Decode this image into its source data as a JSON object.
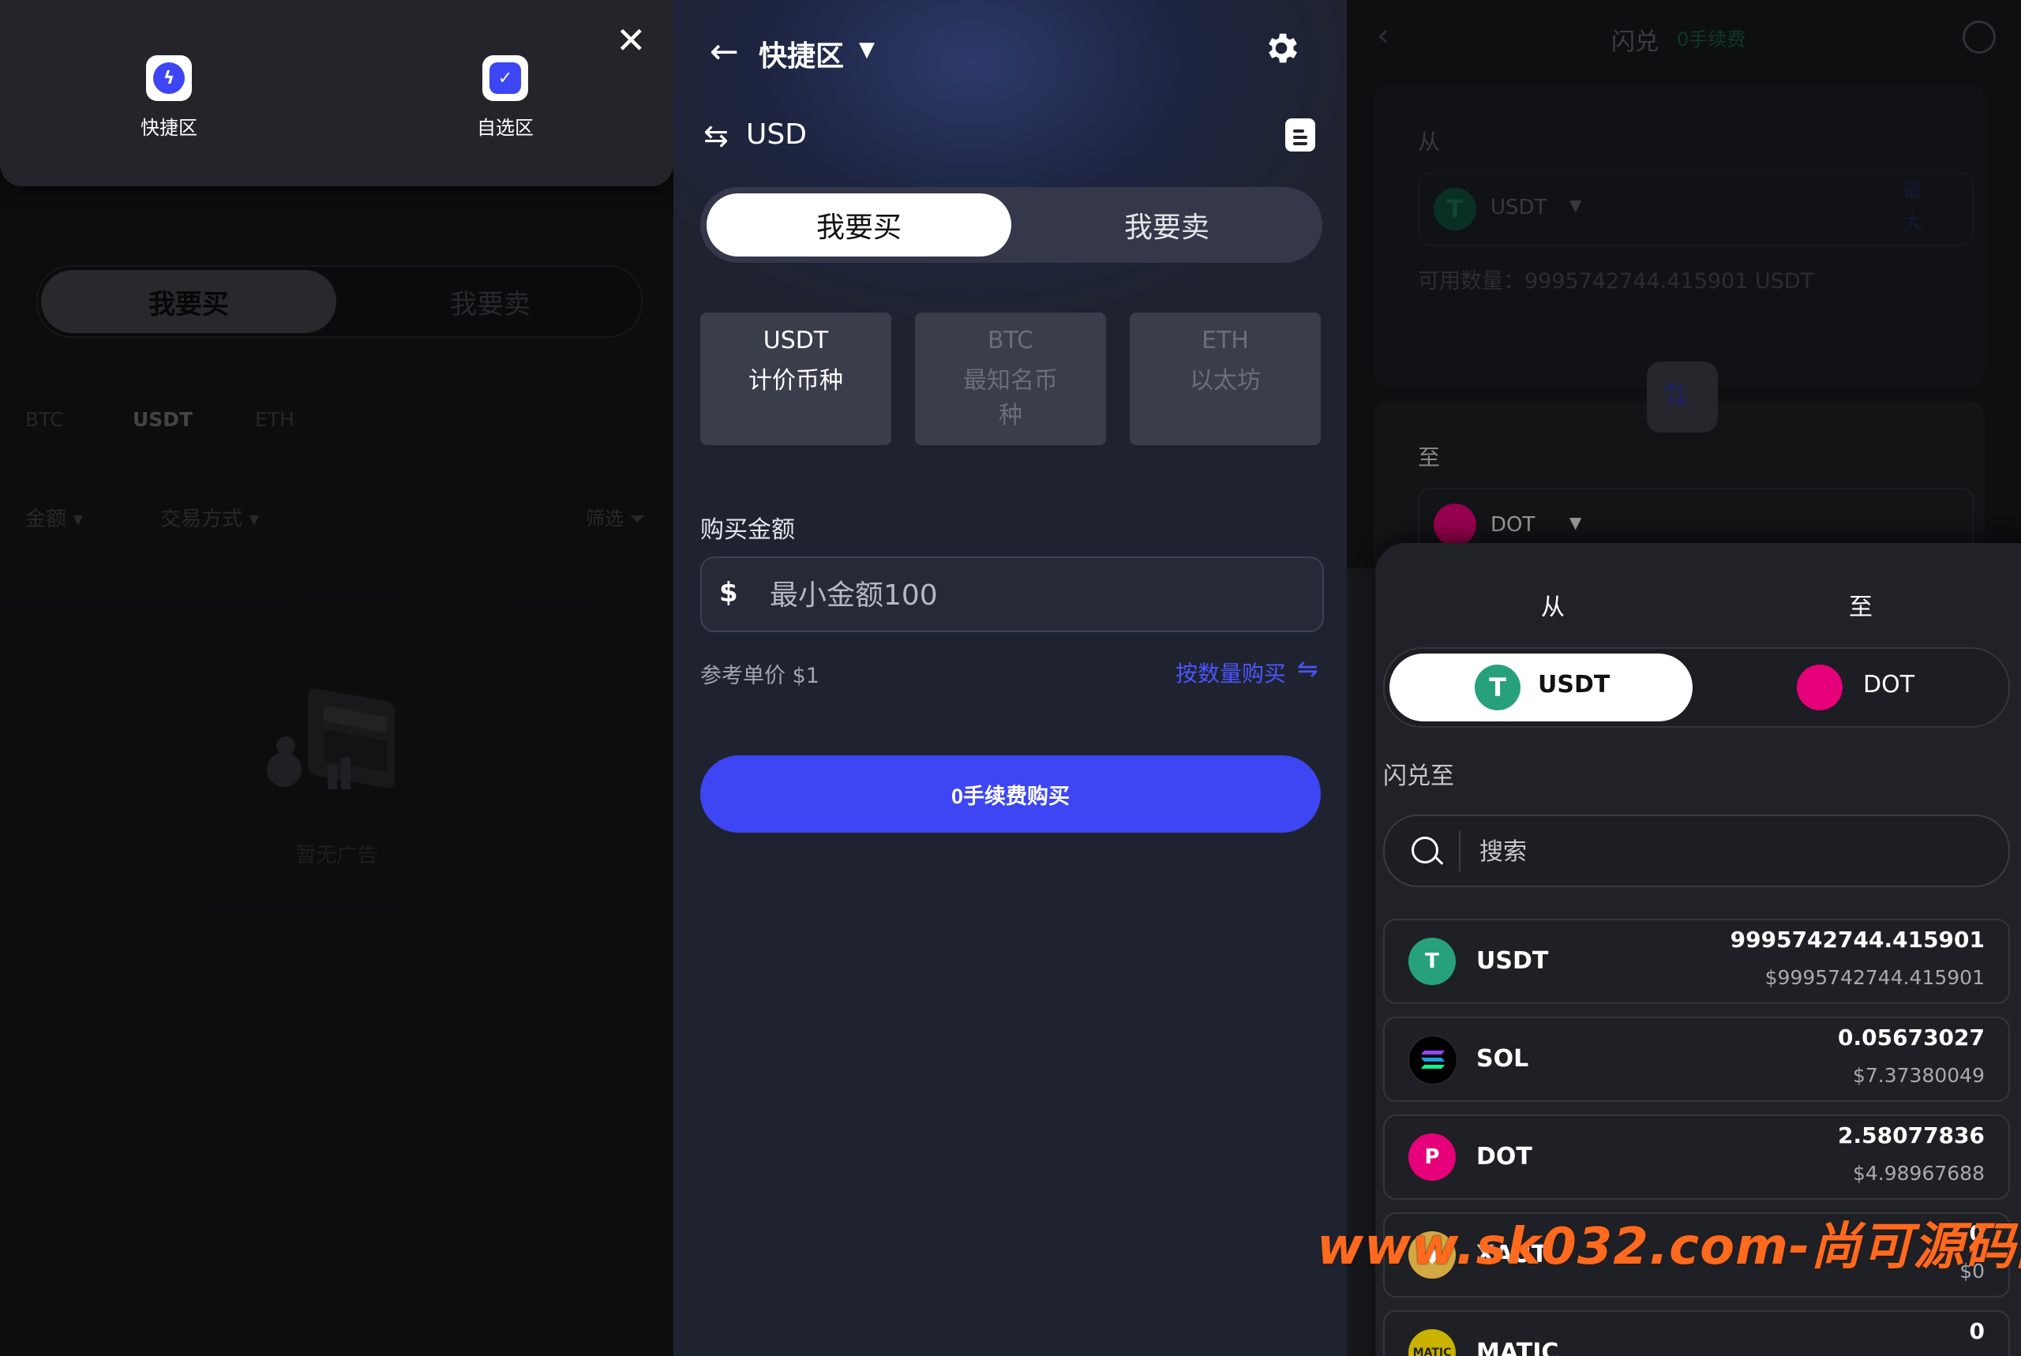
{
  "left_panel": {
    "popup": {
      "items": [
        {
          "label": "快捷区",
          "icon": "quick-zone-icon"
        },
        {
          "label": "自选区",
          "icon": "self-select-icon"
        }
      ],
      "close_icon": "close-icon"
    },
    "segment": {
      "buy": "我要买",
      "sell": "我要卖"
    },
    "coin_tabs": [
      "BTC",
      "USDT",
      "ETH"
    ],
    "active_coin_tab": "USDT",
    "filters": {
      "amount": "金额",
      "trade_method": "交易方式",
      "filter": "筛选"
    },
    "empty_text": "暂无广告"
  },
  "middle_panel": {
    "title": "快捷区",
    "currency": "USD",
    "segment": {
      "buy": "我要买",
      "sell": "我要卖"
    },
    "currency_cards": [
      {
        "code": "USDT",
        "desc": "计价币种",
        "selected": true
      },
      {
        "code": "BTC",
        "desc": "最知名币种",
        "selected": false
      },
      {
        "code": "ETH",
        "desc": "以太坊",
        "selected": false
      }
    ],
    "buy_amount_label": "购买金额",
    "amount_symbol": "$",
    "amount_placeholder": "最小金额100",
    "ref_price": "参考单价 $1",
    "buy_by_quantity": "按数量购买",
    "buy_button": "0手续费购买",
    "colors": {
      "accent": "#3d46f2"
    }
  },
  "right_panel": {
    "header": {
      "title": "闪兑",
      "fee": "0手续费"
    },
    "from_label": "从",
    "from_coin": "USDT",
    "max_label": "最大",
    "available": "可用数量：9995742744.415901 USDT",
    "to_label": "至",
    "to_coin": "DOT",
    "sheet": {
      "tab_from": "从",
      "tab_to": "至",
      "seg_from": "USDT",
      "seg_to": "DOT",
      "swap_to_label": "闪兑至",
      "search_placeholder": "搜索",
      "assets": [
        {
          "symbol": "USDT",
          "amount": "9995742744.415901",
          "usd": "$9995742744.415901",
          "color": "#26a17b"
        },
        {
          "symbol": "SOL",
          "amount": "0.05673027",
          "usd": "$7.37380049",
          "color": "#000000"
        },
        {
          "symbol": "DOT",
          "amount": "2.58077836",
          "usd": "$4.98967688",
          "color": "#e6007a"
        },
        {
          "symbol": "XAUT",
          "amount": "0",
          "usd": "$0",
          "color": "#d4a843"
        },
        {
          "symbol": "MATIC",
          "amount": "0",
          "usd": "",
          "color": "#c9b200"
        }
      ]
    }
  },
  "watermark": "www.sk032.com-尚可源码网"
}
